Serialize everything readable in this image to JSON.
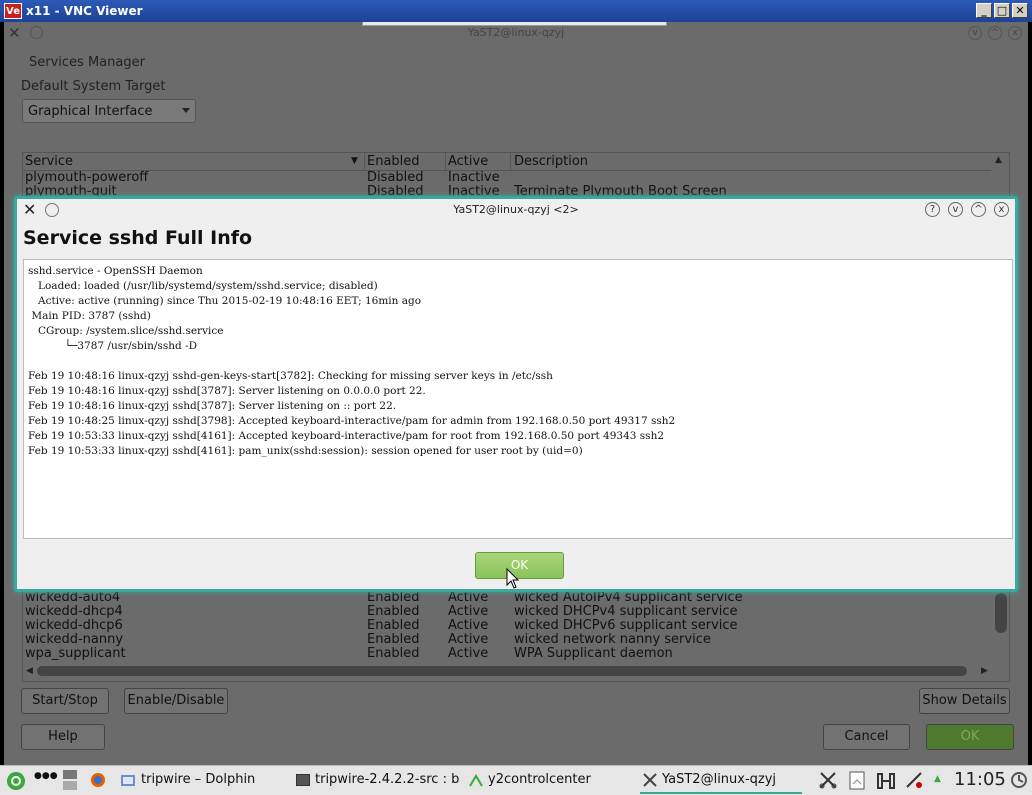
{
  "vnc": {
    "title": "x11 - VNC Viewer",
    "logo": "Ve",
    "ctrl_min": "_",
    "ctrl_max": "□",
    "ctrl_close": "✕"
  },
  "background_window": {
    "title": "YaST2@linux-qzyj",
    "module_title": "Services Manager",
    "target_label": "Default System Target",
    "target_value": "Graphical Interface",
    "columns": [
      "Service",
      "Enabled",
      "Active",
      "Description"
    ],
    "rows_top": [
      {
        "service": "plymouth-poweroff",
        "enabled": "Disabled",
        "active": "Inactive",
        "description": ""
      },
      {
        "service": "plymouth-quit",
        "enabled": "Disabled",
        "active": "Inactive",
        "description": "Terminate Plymouth Boot Screen"
      }
    ],
    "rows_bottom": [
      {
        "service": "wickedd-auto4",
        "enabled": "Enabled",
        "active": "Active",
        "description": "wicked AutoIPv4 supplicant service"
      },
      {
        "service": "wickedd-dhcp4",
        "enabled": "Enabled",
        "active": "Active",
        "description": "wicked DHCPv4 supplicant service"
      },
      {
        "service": "wickedd-dhcp6",
        "enabled": "Enabled",
        "active": "Active",
        "description": "wicked DHCPv6 supplicant service"
      },
      {
        "service": "wickedd-nanny",
        "enabled": "Enabled",
        "active": "Active",
        "description": "wicked network nanny service"
      },
      {
        "service": "wpa_supplicant",
        "enabled": "Enabled",
        "active": "Active",
        "description": "WPA Supplicant daemon"
      }
    ],
    "buttons": {
      "start_stop": "Start/Stop",
      "enable_disable": "Enable/Disable",
      "show_details": "Show Details",
      "help": "Help",
      "cancel": "Cancel",
      "ok": "OK"
    }
  },
  "dialog": {
    "title": "YaST2@linux-qzyj <2>",
    "heading": "Service sshd Full Info",
    "log_lines": [
      "sshd.service - OpenSSH Daemon",
      "   Loaded: loaded (/usr/lib/systemd/system/sshd.service; disabled)",
      "   Active: active (running) since Thu 2015-02-19 10:48:16 EET; 16min ago",
      " Main PID: 3787 (sshd)",
      "   CGroup: /system.slice/sshd.service",
      "           └─3787 /usr/sbin/sshd -D",
      "",
      "Feb 19 10:48:16 linux-qzyj sshd-gen-keys-start[3782]: Checking for missing server keys in /etc/ssh",
      "Feb 19 10:48:16 linux-qzyj sshd[3787]: Server listening on 0.0.0.0 port 22.",
      "Feb 19 10:48:16 linux-qzyj sshd[3787]: Server listening on :: port 22.",
      "Feb 19 10:48:25 linux-qzyj sshd[3798]: Accepted keyboard-interactive/pam for admin from 192.168.0.50 port 49317 ssh2",
      "Feb 19 10:53:33 linux-qzyj sshd[4161]: Accepted keyboard-interactive/pam for root from 192.168.0.50 port 49343 ssh2",
      "Feb 19 10:53:33 linux-qzyj sshd[4161]: pam_unix(sshd:session): session opened for user root by (uid=0)"
    ],
    "ok_label": "OK",
    "ctrl_help": "?",
    "ctrl_min": "v",
    "ctrl_max": "^",
    "ctrl_close": "x"
  },
  "taskbar": {
    "items": [
      {
        "label": "tripwire – Dolphin",
        "icon": "folder-icon"
      },
      {
        "label": "tripwire-2.4.2.2-src : b",
        "icon": "terminal-icon"
      },
      {
        "label": "y2controlcenter",
        "icon": "yast-icon"
      },
      {
        "label": "YaST2@linux-qzyj",
        "icon": "yast-x-icon"
      }
    ],
    "clock": "11:05",
    "dots": "●●●"
  },
  "colors": {
    "accent": "#3aa89c",
    "ok_green": "#8bc25a",
    "vnc_blue": "#2c5ab8"
  }
}
